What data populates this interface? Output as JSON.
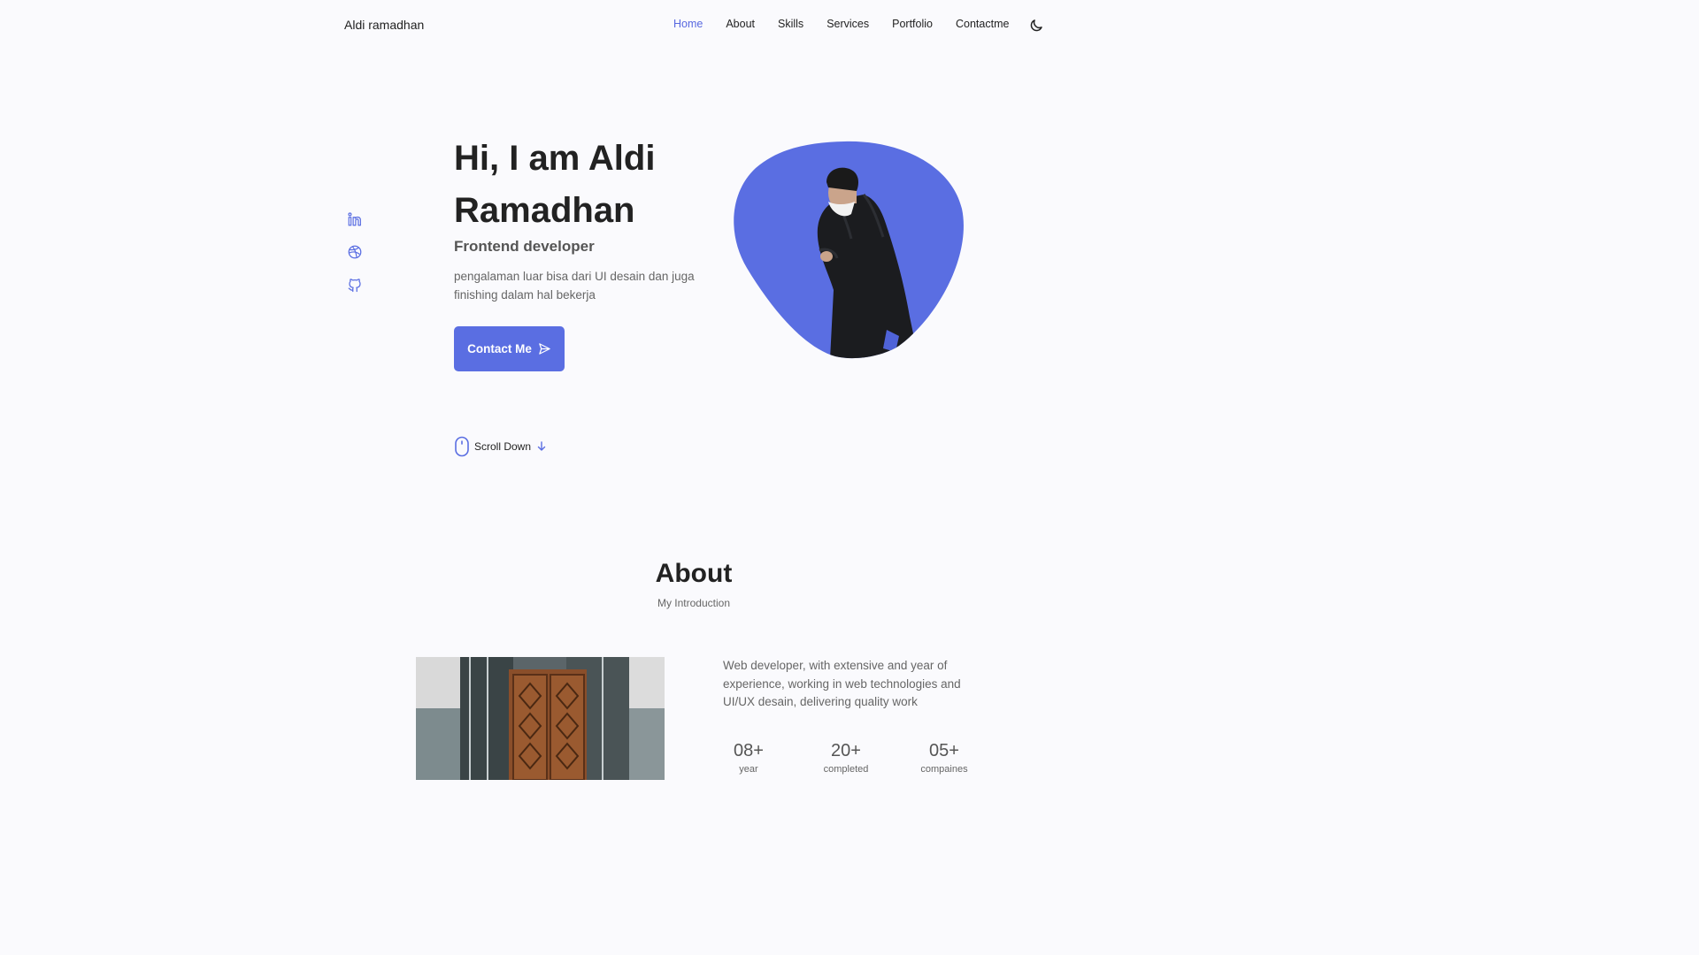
{
  "header": {
    "brand": "Aldi ramadhan",
    "nav": [
      {
        "label": "Home",
        "active": true
      },
      {
        "label": "About",
        "active": false
      },
      {
        "label": "Skills",
        "active": false
      },
      {
        "label": "Services",
        "active": false
      },
      {
        "label": "Portfolio",
        "active": false
      },
      {
        "label": "Contactme",
        "active": false
      }
    ],
    "theme_icon": "moon-icon"
  },
  "social": [
    {
      "icon": "linkedin-icon"
    },
    {
      "icon": "dribbble-icon"
    },
    {
      "icon": "github-icon"
    }
  ],
  "hero": {
    "title": "Hi, I am Aldi Ramadhan",
    "subtitle": "Frontend developer",
    "description": "pengalaman luar bisa dari UI desain dan juga finishing dalam hal bekerja",
    "cta_label": "Contact Me",
    "cta_icon": "send-icon",
    "scroll_label": "Scroll Down",
    "accent": "#5a6ee2"
  },
  "about": {
    "title": "About",
    "subtitle": "My Introduction",
    "description": "Web developer, with extensive and year of experience, working in web technologies and UI/UX desain, delivering quality work",
    "stats": [
      {
        "value": "08+",
        "label": "year"
      },
      {
        "value": "20+",
        "label": "completed"
      },
      {
        "value": "05+",
        "label": "compaines"
      }
    ]
  }
}
